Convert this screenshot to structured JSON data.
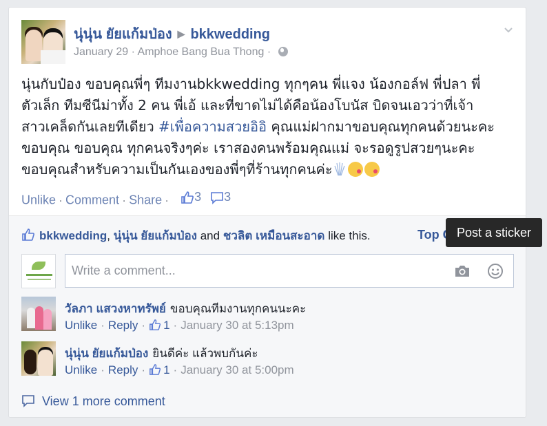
{
  "post": {
    "author": "นุ่นุ่น ยัยแก้มป่อง",
    "page": "bkkwedding",
    "date": "January 29",
    "location": "Amphoe Bang Bua Thong",
    "body_line1": "นุ่นกับป๋อง ขอบคุณพี่ๆ ทีมงานbkkwedding ทุกๆคน พี่แจง น้องกอล์ฟ พี่ปลา พี่",
    "body_line2": "ตัวเล็ก ทีมซีนีม่าทั้ง 2 คน พี่เอ้ และที่ขาดไม่ได้คือน้องโบนัส บิดจนเอวว่าที่เจ้า",
    "body_line3_pre": "สาวเคล็ดกันเลยทีเดียว ",
    "hashtag": "#เพื่อความสวยอิอิ",
    "body_line3_post": " คุณแม่ฝากมาขอบคุณทุกคนด้วยนะคะ",
    "body_line4": "ขอบคุณ ขอบคุณ ทุกคนจริงๆค่ะ เราสองคนพร้อมคุณแม่ จะรอดูรูปสวยๆนะคะ",
    "body_line5": "ขอบคุณสำหรับความเป็นกันเองของพี่ๆที่ร้านทุกคนค่ะ"
  },
  "actions": {
    "unlike": "Unlike",
    "comment": "Comment",
    "share": "Share",
    "like_count": "3",
    "comment_count": "3"
  },
  "likes": {
    "name1": "bkkwedding",
    "comma": ",",
    "name2": "นุ่นุ่น ยัยแก้มป่อง",
    "and": "and",
    "name3": "ชวลิต เหมือนสะอาด",
    "suffix": "like this.",
    "top_comments": "Top Comments"
  },
  "tooltip": "Post a sticker",
  "composer": {
    "placeholder": "Write a comment..."
  },
  "comments": [
    {
      "author": "วัลภา แสวงหาทรัพย์",
      "text": "ขอบคุณทีมงานทุกคนนะคะ",
      "unlike": "Unlike",
      "reply": "Reply",
      "likes": "1",
      "time": "January 30 at 5:13pm"
    },
    {
      "author": "นุ่นุ่น ยัยแก้มป่อง",
      "text": "ยินดีค่ะ แล้วพบกันค่ะ",
      "unlike": "Unlike",
      "reply": "Reply",
      "likes": "1",
      "time": "January 30 at 5:00pm"
    }
  ],
  "view_more": "View 1 more comment",
  "colors": {
    "link": "#365899",
    "muted": "#90949c",
    "tooltip_bg": "#282828"
  }
}
